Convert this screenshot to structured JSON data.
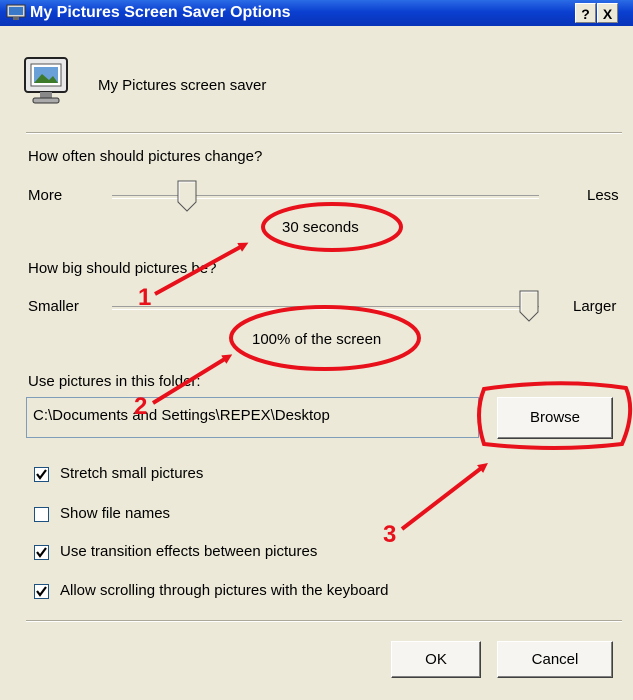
{
  "window": {
    "title": "My Pictures Screen Saver Options",
    "help_glyph": "?",
    "close_glyph": "X"
  },
  "header": {
    "label": "My Pictures screen saver",
    "icon": "monitor-picture-icon"
  },
  "change_interval": {
    "label": "How often should pictures change?",
    "min_label": "More",
    "max_label": "Less",
    "value_text": "30 seconds",
    "position_fraction": 0.16
  },
  "picture_size": {
    "label": "How big should pictures be?",
    "min_label": "Smaller",
    "max_label": "Larger",
    "value_text": "100% of the screen",
    "position_fraction": 1.0
  },
  "folder": {
    "label": "Use pictures in this folder:",
    "path": "C:\\Documents and Settings\\REPEX\\Desktop",
    "browse_label": "Browse"
  },
  "options": [
    {
      "label": "Stretch small pictures",
      "checked": true
    },
    {
      "label": "Show file names",
      "checked": false
    },
    {
      "label": "Use transition effects between pictures",
      "checked": true
    },
    {
      "label": "Allow scrolling through pictures with the keyboard",
      "checked": true
    }
  ],
  "buttons": {
    "ok_label": "OK",
    "cancel_label": "Cancel"
  },
  "annotations": {
    "color": "#e8101a",
    "numbers": [
      "1",
      "2",
      "3"
    ]
  }
}
